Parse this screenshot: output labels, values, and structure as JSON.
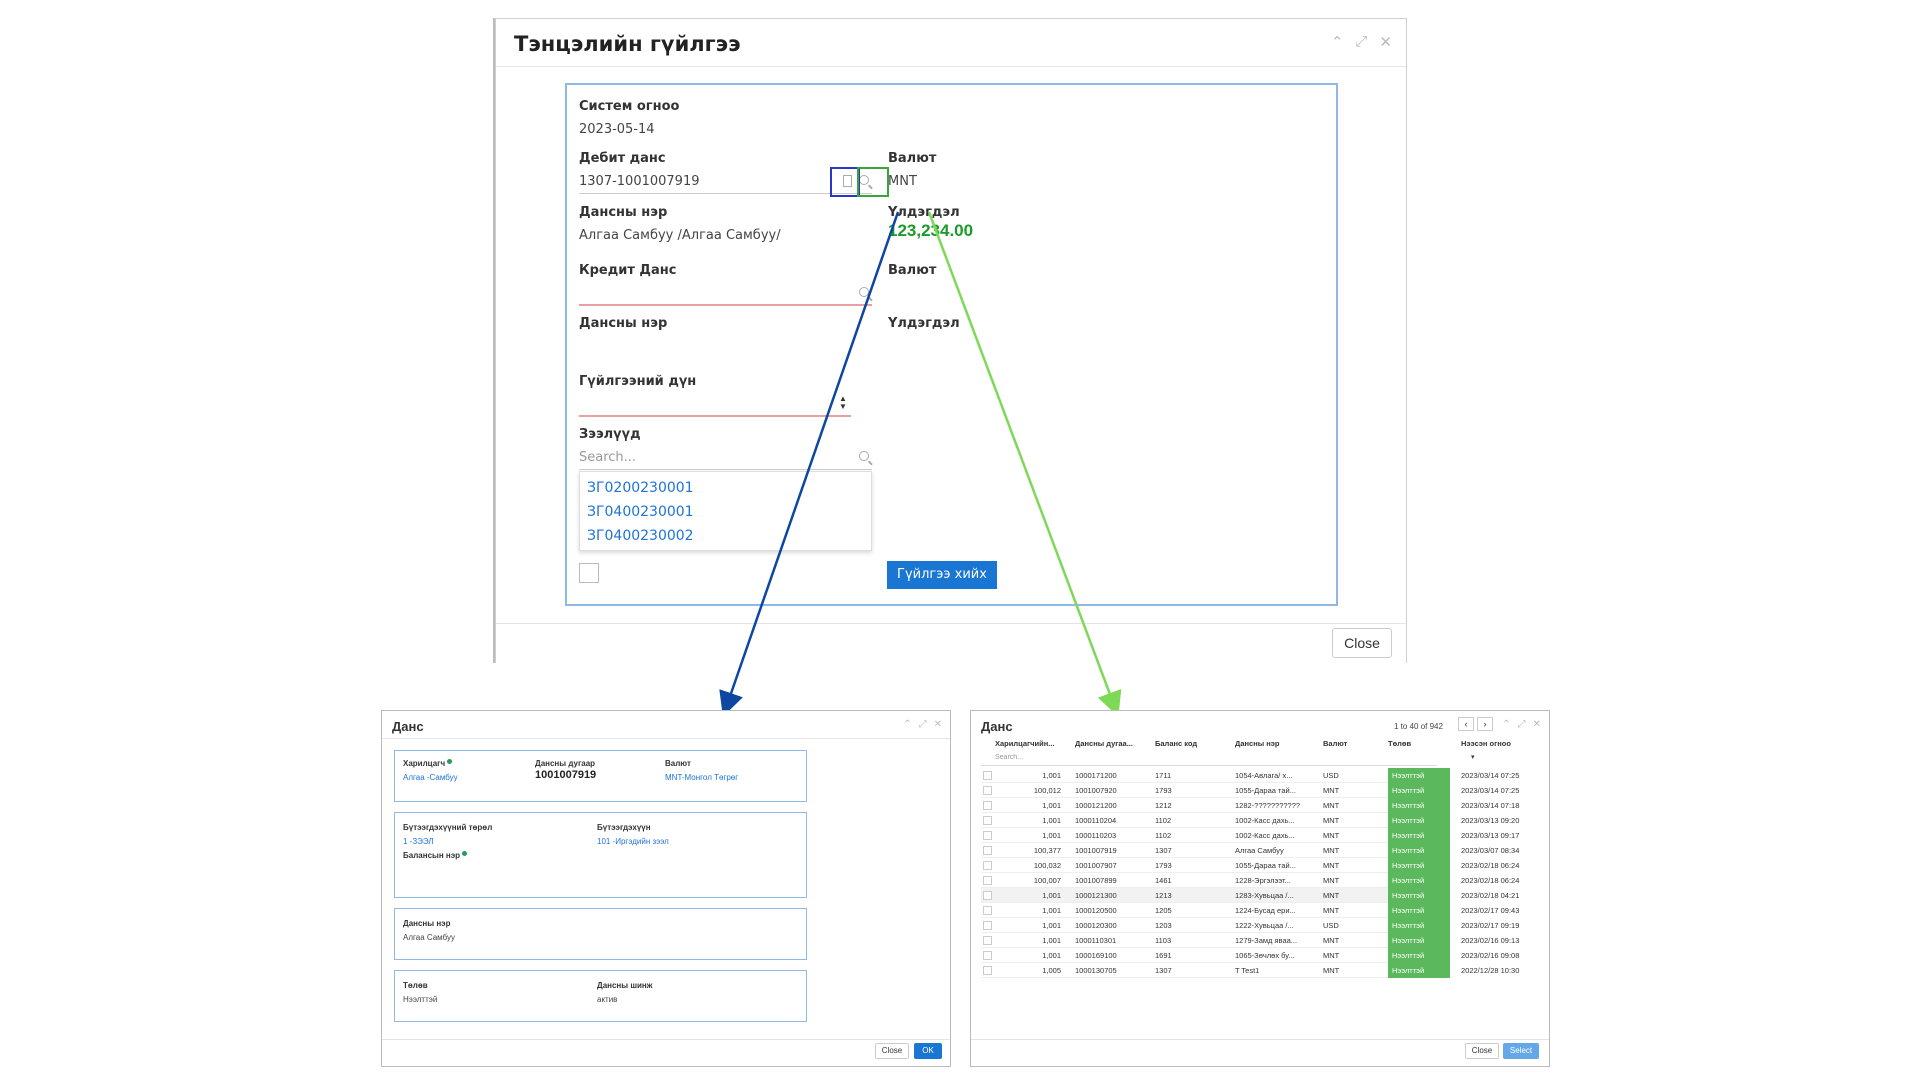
{
  "main": {
    "title": "Тэнцэлийн гүйлгээ",
    "system_date_label": "Систем огноо",
    "system_date": "2023-05-14",
    "debit_label": "Дебит данс",
    "debit_value": "1307-1001007919",
    "currency_label": "Валют",
    "currency_value": "MNT",
    "account_name_label": "Дансны нэр",
    "account_name_value": "Алгаа Самбуу /Алгаа Самбуу/",
    "balance_label": "Үлдэгдэл",
    "balance_value": "123,234.00",
    "credit_label": "Кредит Данс",
    "credit_currency_label": "Валют",
    "credit_account_name_label": "Дансны нэр",
    "credit_balance_label": "Үлдэгдэл",
    "amount_label": "Гүйлгээний дүн",
    "loans_label": "Зээлүүд",
    "loans_placeholder": "Search...",
    "loans_options": [
      "ЗГ0200230001",
      "ЗГ0400230001",
      "ЗГ0400230002"
    ],
    "submit_label": "Гүйлгээ хийх",
    "close_label": "Close"
  },
  "account_modal": {
    "title": "Данс",
    "customer_label": "Харилцагч",
    "customer_value": "Алгаа -Самбуу",
    "account_no_label": "Дансны дугаар",
    "account_no_value": "1001007919",
    "currency_label": "Валют",
    "currency_value": "MNT-Монгол Төгрөг",
    "product_type_label": "Бүтээгдэхүүний төрөл",
    "product_type_value": "1 -ЗЭЭЛ",
    "product_label": "Бүтээгдэхүүн",
    "product_value": "101 -Иргэдийн зээл",
    "balance_name_label": "Балансын нэр",
    "account_name_label": "Дансны нэр",
    "account_name_value": "Алгаа Самбуу",
    "status_label": "Төлөв",
    "status_value": "Нээлттэй",
    "attribute_label": "Дансны шинж",
    "attribute_value": "актив",
    "close_label": "Close",
    "ok_label": "OK"
  },
  "table_modal": {
    "title": "Данс",
    "pager_text": "1 to 40 of 942",
    "columns": [
      "Харилцагчийн...",
      "Дансны дугаа...",
      "Баланс код",
      "Дансны нэр",
      "Валют",
      "Төлөв",
      "Нээсэн огноо"
    ],
    "search_placeholder": "Search...",
    "rows": [
      [
        "1,001",
        "1000171200",
        "1711",
        "1054-Авлага/ х...",
        "USD",
        "Нээлттэй",
        "2023/03/14 07:25"
      ],
      [
        "100,012",
        "1001007920",
        "1793",
        "1055-Дараа тай...",
        "MNT",
        "Нээлттэй",
        "2023/03/14 07:25"
      ],
      [
        "1,001",
        "1000121200",
        "1212",
        "1282-???????????",
        "MNT",
        "Нээлттэй",
        "2023/03/14 07:18"
      ],
      [
        "1,001",
        "1000110204",
        "1102",
        "1002-Касс дахь...",
        "MNT",
        "Нээлттэй",
        "2023/03/13 09:20"
      ],
      [
        "1,001",
        "1000110203",
        "1102",
        "1002-Касс дахь...",
        "MNT",
        "Нээлттэй",
        "2023/03/13 09:17"
      ],
      [
        "100,377",
        "1001007919",
        "1307",
        "Алгаа Самбуу",
        "MNT",
        "Нээлттэй",
        "2023/03/07 08:34"
      ],
      [
        "100,032",
        "1001007907",
        "1793",
        "1055-Дараа тай...",
        "MNT",
        "Нээлттэй",
        "2023/02/18 06:24"
      ],
      [
        "100,007",
        "1001007899",
        "1461",
        "1228-Эргэлээт...",
        "MNT",
        "Нээлттэй",
        "2023/02/18 06:24"
      ],
      [
        "1,001",
        "1000121300",
        "1213",
        "1283-Хувьцаа /...",
        "MNT",
        "Нээлттэй",
        "2023/02/18 04:21"
      ],
      [
        "1,001",
        "1000120500",
        "1205",
        "1224-Бусад ери...",
        "MNT",
        "Нээлттэй",
        "2023/02/17 09:43"
      ],
      [
        "1,001",
        "1000120300",
        "1203",
        "1222-Хувьцаа /...",
        "USD",
        "Нээлттэй",
        "2023/02/17 09:19"
      ],
      [
        "1,001",
        "1000110301",
        "1103",
        "1279-Замд яваа...",
        "MNT",
        "Нээлттэй",
        "2023/02/16 09:13"
      ],
      [
        "1,001",
        "1000169100",
        "1691",
        "1065-Зөчлөх бу...",
        "MNT",
        "Нээлттэй",
        "2023/02/16 09:08"
      ],
      [
        "1,005",
        "1000130705",
        "1307",
        "T Test1",
        "MNT",
        "Нээлттэй",
        "2022/12/28 10:30"
      ]
    ],
    "close_label": "Close",
    "select_label": "Select"
  },
  "colors": {
    "blue_arrow": "#0d47a1",
    "green_arrow": "#7ed957",
    "status_green": "#5cb85c",
    "primary": "#1976d2",
    "balance_green": "#1a9a2a"
  },
  "icons": [
    "document-icon",
    "search-icon",
    "spinner-arrows-icon",
    "minimize-icon",
    "maximize-icon",
    "close-icon",
    "chevron-left-icon",
    "chevron-right-icon",
    "info-dot-icon"
  ]
}
